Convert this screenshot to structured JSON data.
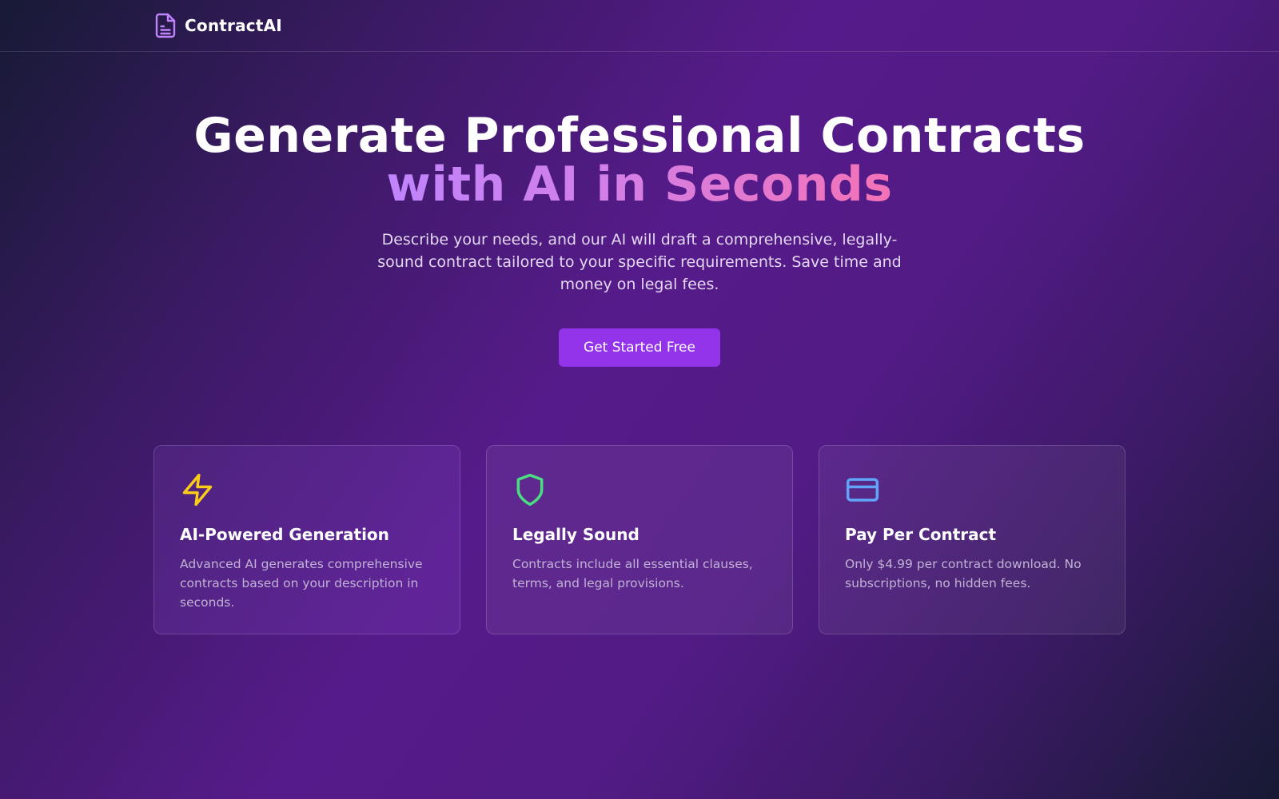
{
  "nav": {
    "brand_name": "ContractAI",
    "brand_icon": "document-icon"
  },
  "hero": {
    "title_line1": "Generate Professional Contracts",
    "title_line2": "with AI in Seconds",
    "subtitle": "Describe your needs, and our AI will draft a comprehensive, legally-sound contract tailored to your specific requirements. Save time and money on legal fees.",
    "cta_label": "Get Started Free"
  },
  "features": [
    {
      "icon": "lightning-icon",
      "title": "AI-Powered Generation",
      "description": "Advanced AI generates comprehensive contracts based on your description in seconds."
    },
    {
      "icon": "shield-icon",
      "title": "Legally Sound",
      "description": "Contracts include all essential clauses, terms, and legal provisions."
    },
    {
      "icon": "credit-card-icon",
      "title": "Pay Per Contract",
      "description": "Only $4.99 per contract download. No subscriptions, no hidden fees."
    }
  ],
  "colors": {
    "accent": "#9333ea",
    "brand_icon": "#c084fc",
    "gradient_start": "#c084fc",
    "gradient_end": "#f472b6",
    "lightning": "#facc15",
    "shield": "#4ade80",
    "card": "#60a5fa"
  }
}
